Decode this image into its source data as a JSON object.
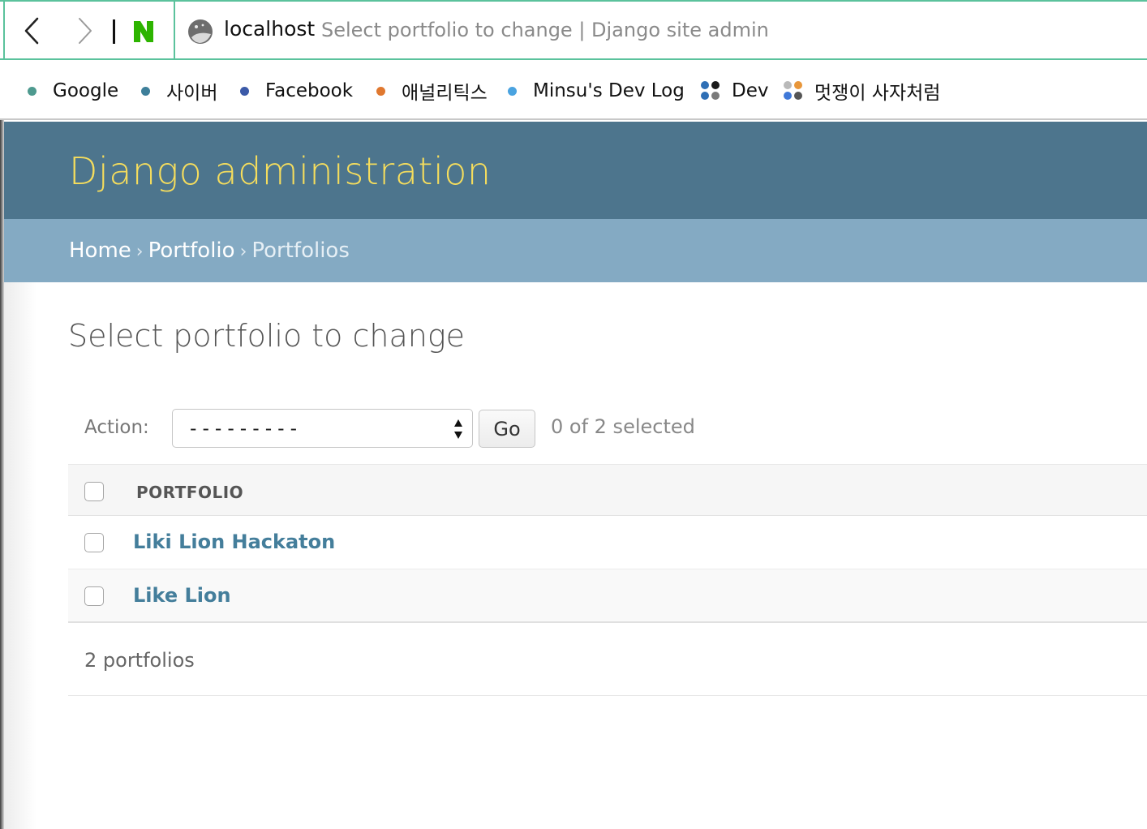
{
  "browser": {
    "url_host": "localhost",
    "tab_title": "Select portfolio to change | Django site admin"
  },
  "bookmarks": [
    {
      "label": "Google",
      "dot_color": "#4e9a8f"
    },
    {
      "label": "사이버",
      "dot_color": "#3e7f9a"
    },
    {
      "label": "Facebook",
      "dot_color": "#3b5aa8"
    },
    {
      "label": "애널리틱스",
      "dot_color": "#e0782f"
    },
    {
      "label": "Minsu's Dev Log",
      "dot_color": "#4aa3e0"
    },
    {
      "label": "Dev",
      "icon": "folder-grid-icon"
    },
    {
      "label": "멋쟁이 사자처럼",
      "icon": "folder-grid-icon"
    }
  ],
  "header": {
    "site_title": "Django administration"
  },
  "breadcrumbs": {
    "home": "Home",
    "app": "Portfolio",
    "current": "Portfolios",
    "separator": "›"
  },
  "page": {
    "title": "Select portfolio to change"
  },
  "actions": {
    "label": "Action:",
    "selected_value": "---------",
    "go_label": "Go",
    "selection_count": "0 of 2 selected"
  },
  "table": {
    "column_header": "PORTFOLIO",
    "rows": [
      {
        "title": "Liki Lion Hackaton"
      },
      {
        "title": "Like Lion"
      }
    ]
  },
  "paginator": {
    "count_text": "2 portfolios"
  },
  "colors": {
    "header_bg": "#4d758d",
    "title_yellow": "#f5dd5d",
    "breadcrumb_bg": "#84aac3",
    "link": "#447e9b"
  }
}
